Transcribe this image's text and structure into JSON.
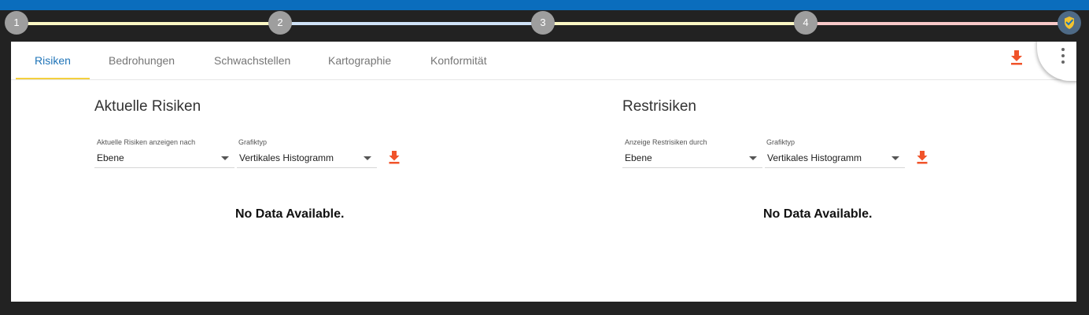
{
  "stepper": {
    "steps": [
      "1",
      "2",
      "3",
      "4"
    ],
    "colors": [
      "#fbf7c4",
      "#cfe2f7",
      "#fbf7c4",
      "#f8c9c9"
    ]
  },
  "tabs": [
    {
      "label": "Risiken",
      "active": true
    },
    {
      "label": "Bedrohungen"
    },
    {
      "label": "Schwachstellen"
    },
    {
      "label": "Kartographie"
    },
    {
      "label": "Konformität"
    }
  ],
  "left": {
    "title": "Aktuelle Risiken",
    "filter_label": "Aktuelle Risiken anzeigen nach",
    "filter_value": "Ebene",
    "chart_type_label": "Grafiktyp",
    "chart_type_value": "Vertikales Histogramm",
    "empty_message": "No Data Available."
  },
  "right": {
    "title": "Restrisiken",
    "filter_label": "Anzeige Restrisiken durch",
    "filter_value": "Ebene",
    "chart_type_label": "Grafiktyp",
    "chart_type_value": "Vertikales Histogramm",
    "empty_message": "No Data Available."
  },
  "icons": {
    "download": "download-icon",
    "more": "more-vert-icon",
    "step_end": "shield-icon"
  },
  "colors": {
    "header": "#0a6dbd",
    "accent": "#f0532a",
    "active_tab": "#1f74b8",
    "tab_indicator": "#f4d03f"
  }
}
